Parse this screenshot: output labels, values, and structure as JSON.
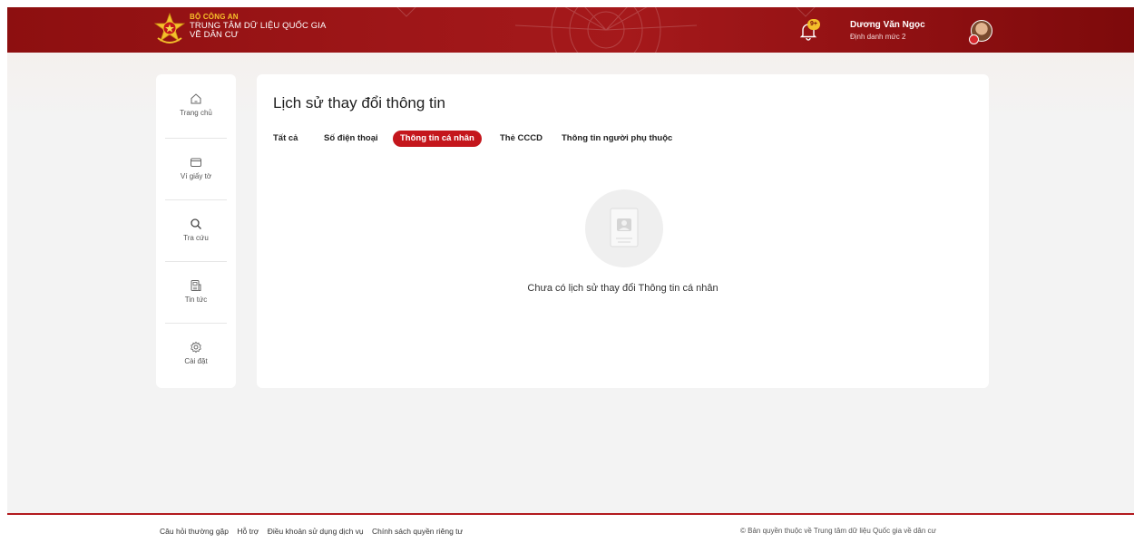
{
  "header": {
    "brand_line1": "BỘ CÔNG AN",
    "brand_line2": "TRUNG TÂM DỮ LIỆU QUỐC GIA",
    "brand_line3": "VỀ DÂN CƯ",
    "notification_badge": "9+",
    "user_name": "Dương Văn Ngọc",
    "user_level": "Định danh mức 2"
  },
  "sidebar": {
    "items": [
      {
        "label": "Trang chủ",
        "icon": "home-icon"
      },
      {
        "label": "Ví giấy tờ",
        "icon": "wallet-icon"
      },
      {
        "label": "Tra cứu",
        "icon": "search-icon"
      },
      {
        "label": "Tin tức",
        "icon": "news-icon"
      },
      {
        "label": "Cài đặt",
        "icon": "gear-icon"
      }
    ]
  },
  "main": {
    "title": "Lịch sử thay đổi thông tin",
    "tabs": [
      {
        "label": "Tất cả",
        "active": false
      },
      {
        "label": "Số điện thoại",
        "active": false
      },
      {
        "label": "Thông tin cá nhân",
        "active": true
      },
      {
        "label": "Thẻ CCCD",
        "active": false
      },
      {
        "label": "Thông tin người phụ thuộc",
        "active": false
      }
    ],
    "empty_message": "Chưa có lịch sử thay đổi Thông tin cá nhân"
  },
  "footer": {
    "links": [
      "Câu hỏi thường gặp",
      "Hỗ trợ",
      "Điều khoản sử dụng dịch vụ",
      "Chính sách quyền riêng tư"
    ],
    "copyright": "© Bản quyền thuộc về Trung tâm dữ liệu Quốc gia về dân cư"
  },
  "colors": {
    "brand_red": "#a5191b",
    "active_tab": "#c4161c",
    "brand_gold": "#f7c02a"
  }
}
